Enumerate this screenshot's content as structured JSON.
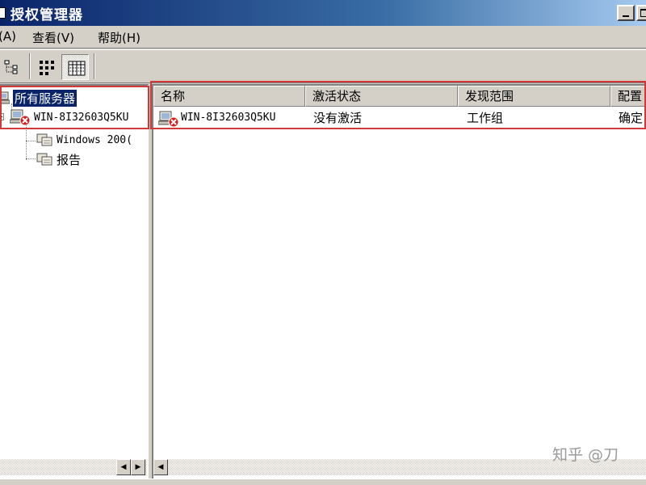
{
  "window": {
    "title": "授权管理器"
  },
  "menu": {
    "items": [
      {
        "label": "(A)"
      },
      {
        "label": "查看(V)"
      },
      {
        "label": "帮助(H)"
      }
    ]
  },
  "toolbar": {
    "buttons": [
      {
        "icon": "tree-view-icon"
      },
      {
        "icon": "small-icons-view-icon"
      },
      {
        "icon": "details-view-icon",
        "pressed": true
      }
    ]
  },
  "tree": {
    "root": {
      "label": "所有服务器",
      "icon": "servers-icon"
    },
    "server": {
      "label": "WIN-8I32603Q5KU",
      "icon": "server-error-icon"
    },
    "children": [
      {
        "label": "Windows 200(",
        "icon": "product-icon"
      },
      {
        "label": "报告",
        "icon": "report-icon"
      }
    ]
  },
  "list": {
    "columns": [
      "名称",
      "激活状态",
      "发现范围",
      "配置"
    ],
    "rows": [
      {
        "name": "WIN-8I32603Q5KU",
        "status": "没有激活",
        "scope": "工作组",
        "config": "确定"
      }
    ]
  },
  "watermark": "知乎 @刀",
  "colors": {
    "titlebar_start": "#0a246a",
    "titlebar_end": "#a6caf0",
    "selection": "#0a246a",
    "highlight_box": "#d23a3a",
    "error_badge": "#d22020"
  }
}
